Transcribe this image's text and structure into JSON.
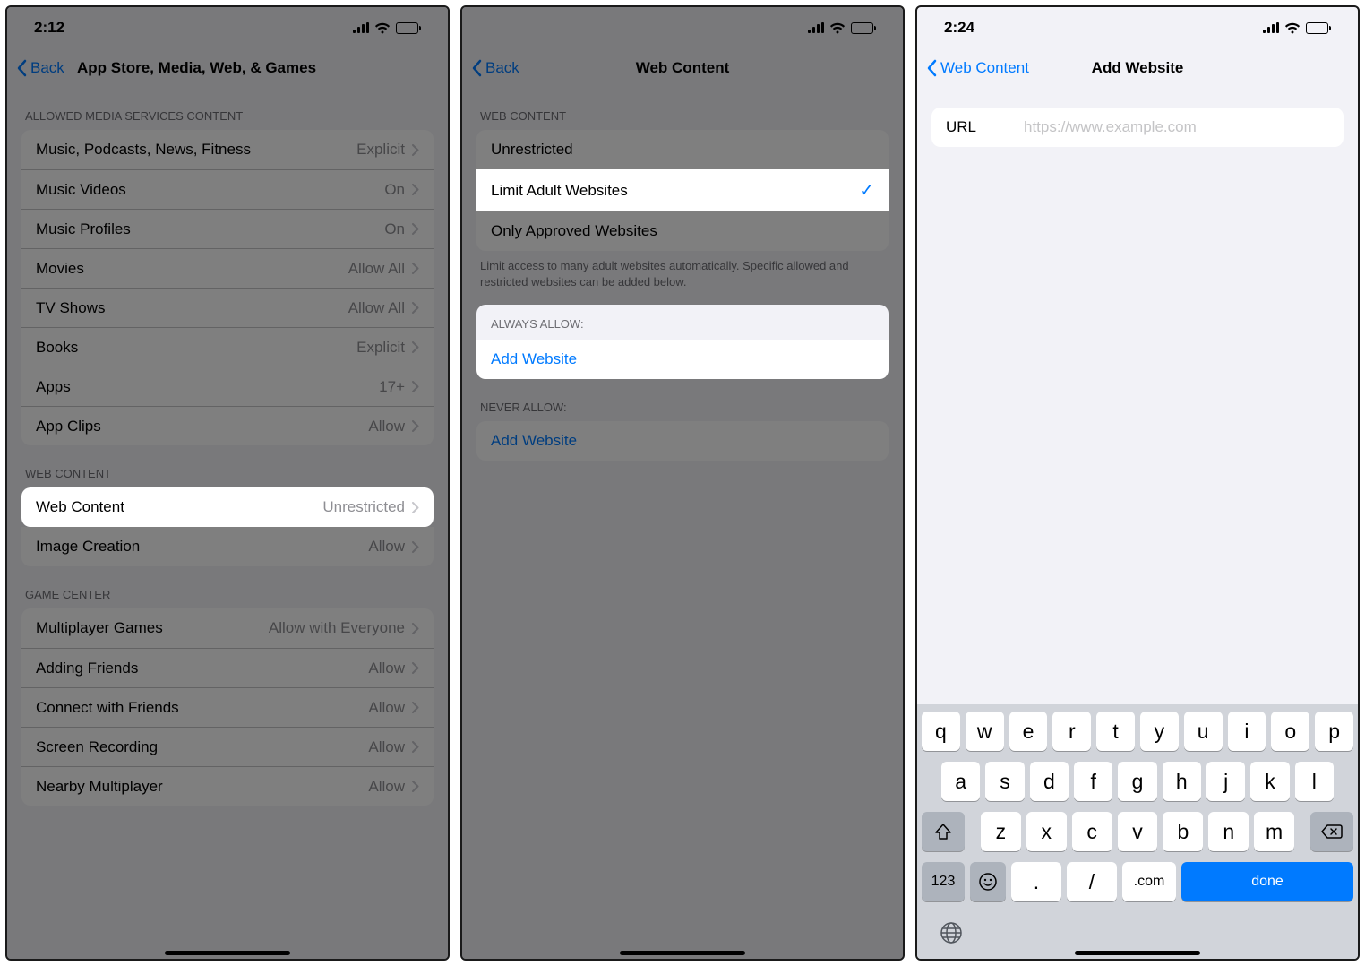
{
  "screen1": {
    "status": {
      "time": "2:12"
    },
    "nav": {
      "back": "Back",
      "title": "App Store, Media, Web, & Games"
    },
    "sec_media_header": "ALLOWED MEDIA SERVICES CONTENT",
    "media_rows": [
      {
        "label": "Music, Podcasts, News, Fitness",
        "detail": "Explicit"
      },
      {
        "label": "Music Videos",
        "detail": "On"
      },
      {
        "label": "Music Profiles",
        "detail": "On"
      },
      {
        "label": "Movies",
        "detail": "Allow All"
      },
      {
        "label": "TV Shows",
        "detail": "Allow All"
      },
      {
        "label": "Books",
        "detail": "Explicit"
      },
      {
        "label": "Apps",
        "detail": "17+"
      },
      {
        "label": "App Clips",
        "detail": "Allow"
      }
    ],
    "sec_web_header": "WEB CONTENT",
    "web_rows": [
      {
        "label": "Web Content",
        "detail": "Unrestricted"
      },
      {
        "label": "Image Creation",
        "detail": "Allow"
      }
    ],
    "sec_gc_header": "GAME CENTER",
    "gc_rows": [
      {
        "label": "Multiplayer Games",
        "detail": "Allow with Everyone"
      },
      {
        "label": "Adding Friends",
        "detail": "Allow"
      },
      {
        "label": "Connect with Friends",
        "detail": "Allow"
      },
      {
        "label": "Screen Recording",
        "detail": "Allow"
      },
      {
        "label": "Nearby Multiplayer",
        "detail": "Allow"
      }
    ]
  },
  "screen2": {
    "nav": {
      "back": "Back",
      "title": "Web Content"
    },
    "sec_wc_header": "WEB CONTENT",
    "options": [
      {
        "label": "Unrestricted",
        "checked": false
      },
      {
        "label": "Limit Adult Websites",
        "checked": true
      },
      {
        "label": "Only Approved Websites",
        "checked": false
      }
    ],
    "footer": "Limit access to many adult websites automatically. Specific allowed and restricted websites can be added below.",
    "sec_always_header": "ALWAYS ALLOW:",
    "always_add": "Add Website",
    "sec_never_header": "NEVER ALLOW:",
    "never_add": "Add Website"
  },
  "screen3": {
    "status": {
      "time": "2:24"
    },
    "nav": {
      "back": "Web Content",
      "title": "Add Website"
    },
    "url_label": "URL",
    "url_placeholder": "https://www.example.com",
    "keyboard": {
      "row1": [
        "q",
        "w",
        "e",
        "r",
        "t",
        "y",
        "u",
        "i",
        "o",
        "p"
      ],
      "row2": [
        "a",
        "s",
        "d",
        "f",
        "g",
        "h",
        "j",
        "k",
        "l"
      ],
      "row3": [
        "z",
        "x",
        "c",
        "v",
        "b",
        "n",
        "m"
      ],
      "num": "123",
      "dot": ".",
      "slash": "/",
      "com": ".com",
      "done": "done"
    }
  }
}
